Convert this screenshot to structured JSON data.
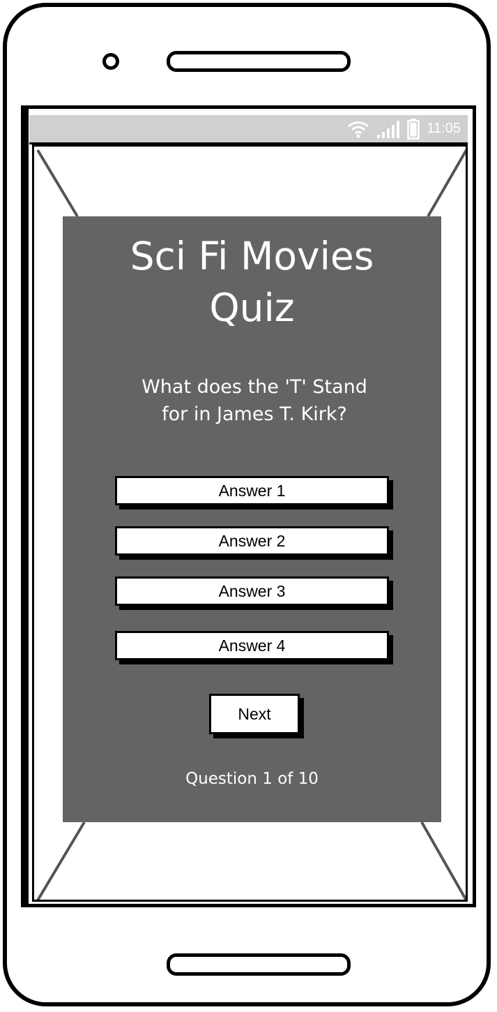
{
  "status_bar": {
    "time": "11:05",
    "icons": [
      "wifi-icon",
      "signal-icon",
      "battery-icon"
    ]
  },
  "quiz": {
    "title": "Sci Fi Movies\nQuiz",
    "question": "What does the 'T' Stand\nfor in James T. Kirk?",
    "answers": [
      {
        "label": "Answer 1"
      },
      {
        "label": "Answer 2"
      },
      {
        "label": "Answer 3"
      },
      {
        "label": "Answer 4"
      }
    ],
    "next_label": "Next",
    "progress_text": "Question 1 of 10"
  },
  "colors": {
    "card_background": "#646464",
    "status_bar_background": "#d0d0d0",
    "text_on_card": "#ffffff"
  }
}
